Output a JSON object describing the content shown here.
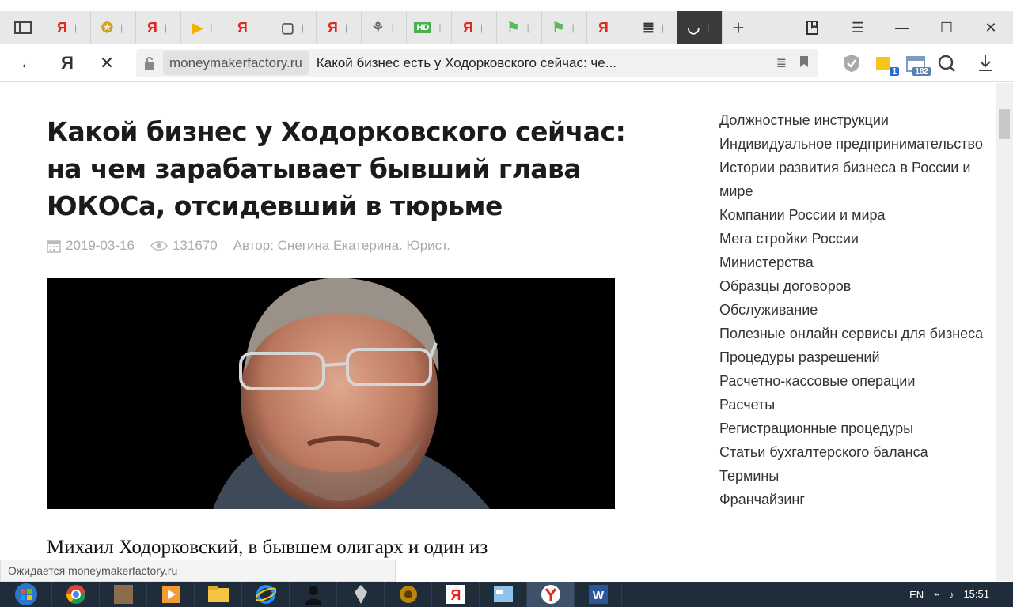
{
  "browser": {
    "tabs": [
      {
        "icon": "yandex-icon",
        "glyph": "Я",
        "color": "#e52620"
      },
      {
        "icon": "puzzle-icon",
        "glyph": "✪",
        "color": "#d4a017"
      },
      {
        "icon": "yandex-icon",
        "glyph": "Я",
        "color": "#e52620"
      },
      {
        "icon": "play-icon",
        "glyph": "▶",
        "color": "#f2b300"
      },
      {
        "icon": "yandex-icon",
        "glyph": "Я",
        "color": "#e52620"
      },
      {
        "icon": "document-icon",
        "glyph": "▢",
        "color": "#555555"
      },
      {
        "icon": "yandex-icon",
        "glyph": "Я",
        "color": "#e52620"
      },
      {
        "icon": "avatar-icon",
        "glyph": "⚘",
        "color": "#666666"
      },
      {
        "icon": "hd-icon",
        "glyph": "HD",
        "color": "#4caf50"
      },
      {
        "icon": "yandex-icon",
        "glyph": "Я",
        "color": "#e52620"
      },
      {
        "icon": "leaf-icon",
        "glyph": "⚑",
        "color": "#5cb85c"
      },
      {
        "icon": "leaf-icon",
        "glyph": "⚑",
        "color": "#5cb85c"
      },
      {
        "icon": "yandex-icon",
        "glyph": "Я",
        "color": "#e52620"
      },
      {
        "icon": "stack-icon",
        "glyph": "≣",
        "color": "#333333"
      },
      {
        "icon": "loading-icon",
        "glyph": "◡",
        "color": "#ffffff"
      }
    ],
    "new_tab": "+",
    "url_domain": "moneymakerfactory.ru",
    "url_title": "Какой бизнес есть у Ходорковского сейчас: че...",
    "nav_yandex": "Я",
    "ext_badge_1": "1",
    "ext_badge_2": "182"
  },
  "article": {
    "title": "Какой бизнес у Ходорковского сейчас: на чем зарабатывает бывший глава ЮКОСа, отсидевший в тюрьме",
    "date": "2019-03-16",
    "views": "131670",
    "author": "Автор: Снегина Екатерина. Юрист.",
    "lede": "Михаил Ходорковский, в бывшем олигарх и один из"
  },
  "sidebar": {
    "categories": [
      "Должностные инструкции",
      "Индивидуальное предпринимательство",
      "Истории развития бизнеса в России и мире",
      "Компании России и мира",
      "Мега стройки России",
      "Министерства",
      "Образцы договоров",
      "Обслуживание",
      "Полезные онлайн сервисы для бизнеса",
      "Процедуры разрешений",
      "Расчетно-кассовые операции",
      "Расчеты",
      "Регистрационные процедуры",
      "Статьи бухгалтерского баланса",
      "Термины",
      "Франчайзинг"
    ]
  },
  "status": {
    "text": "Ожидается moneymakerfactory.ru"
  },
  "taskbar": {
    "lang": "EN",
    "time": "15:51"
  }
}
